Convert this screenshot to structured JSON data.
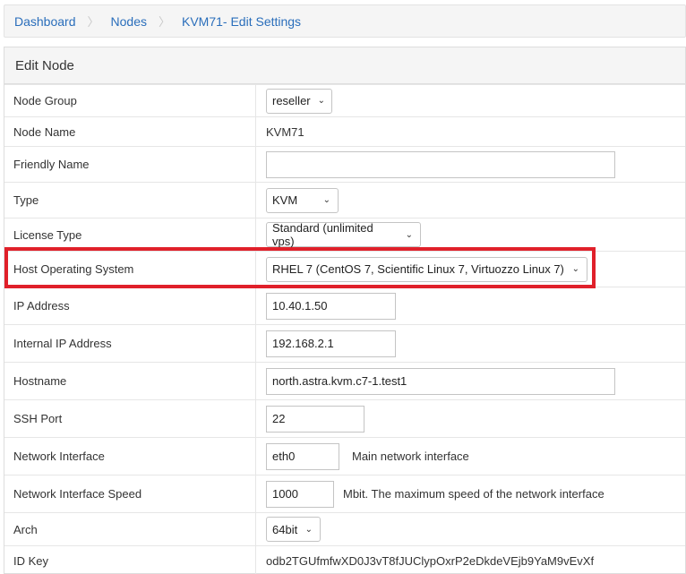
{
  "breadcrumb": {
    "items": [
      "Dashboard",
      "Nodes",
      "KVM71- Edit Settings"
    ]
  },
  "panel": {
    "title": "Edit Node"
  },
  "form": {
    "node_group": {
      "label": "Node Group",
      "value": "reseller"
    },
    "node_name": {
      "label": "Node Name",
      "value": "KVM71"
    },
    "friendly_name": {
      "label": "Friendly Name",
      "value": ""
    },
    "type": {
      "label": "Type",
      "value": "KVM"
    },
    "license_type": {
      "label": "License Type",
      "value": "Standard (unlimited vps)"
    },
    "host_os": {
      "label": "Host Operating System",
      "value": "RHEL 7 (CentOS 7, Scientific Linux 7, Virtuozzo Linux 7)"
    },
    "ip_address": {
      "label": "IP Address",
      "value": "10.40.1.50"
    },
    "internal_ip": {
      "label": "Internal IP Address",
      "value": "192.168.2.1"
    },
    "hostname": {
      "label": "Hostname",
      "value": "north.astra.kvm.c7-1.test1"
    },
    "ssh_port": {
      "label": "SSH Port",
      "value": "22"
    },
    "network_interface": {
      "label": "Network Interface",
      "value": "eth0",
      "help": "Main network interface"
    },
    "network_speed": {
      "label": "Network Interface Speed",
      "value": "1000",
      "help": "Mbit. The maximum speed of the network interface"
    },
    "arch": {
      "label": "Arch",
      "value": "64bit"
    },
    "id_key": {
      "label": "ID Key",
      "value": "odb2TGUfmfwXD0J3vT8fJUClypOxrP2eDkdeVEjb9YaM9vEvXf"
    }
  },
  "icons": {
    "select_chevron": "chevron-down-icon"
  },
  "colors": {
    "link": "#2a6ebb",
    "highlight": "#e0202a"
  }
}
